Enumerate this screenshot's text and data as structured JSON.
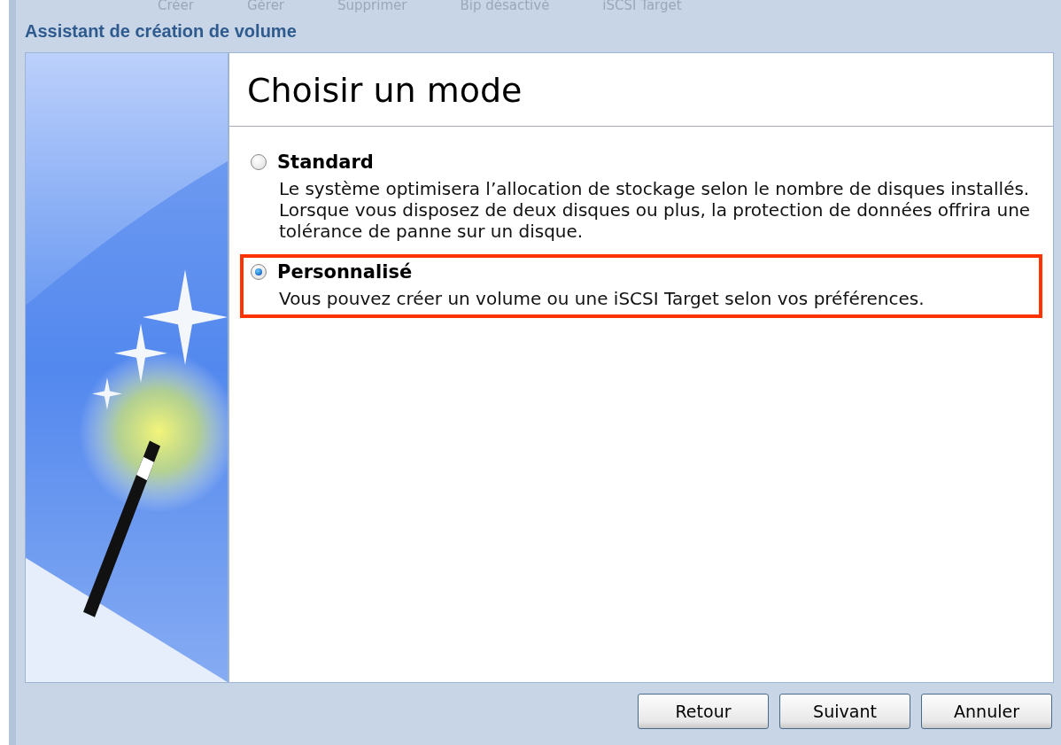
{
  "background_toolbar": [
    "Créer",
    "Gérer",
    "Supprimer",
    "Bip désactivé",
    "iSCSI Target"
  ],
  "window": {
    "title": "Assistant de création de volume"
  },
  "page": {
    "heading": "Choisir un mode"
  },
  "options": [
    {
      "label": "Standard",
      "description": "Le système optimisera l’allocation de stockage selon le nombre de disques installés. Lorsque vous disposez de deux disques ou plus, la protection de données offrira une tolérance de panne sur un disque.",
      "selected": false
    },
    {
      "label": "Personnalisé",
      "description": "Vous pouvez créer un volume ou une iSCSI Target selon vos préférences.",
      "selected": true
    }
  ],
  "buttons": [
    "Retour",
    "Suivant",
    "Annuler"
  ]
}
